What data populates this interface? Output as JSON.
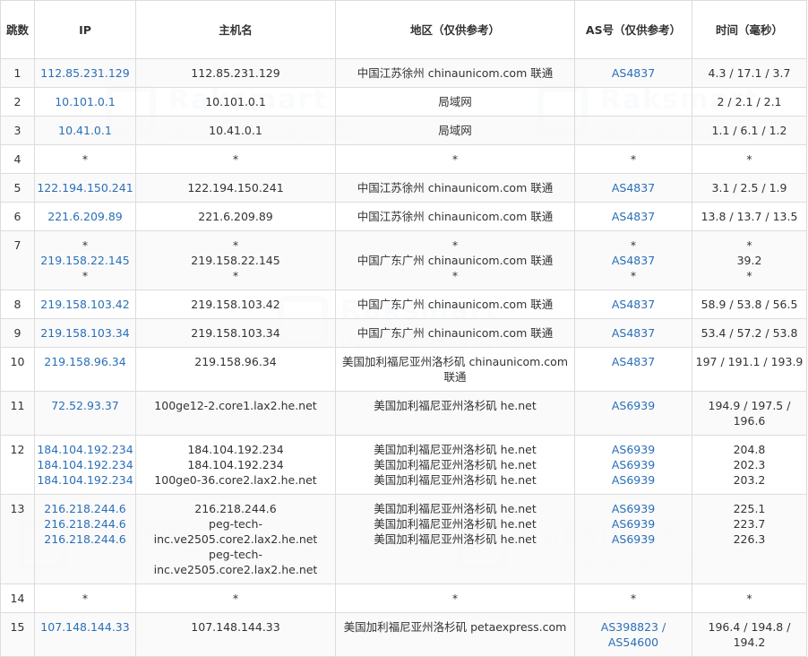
{
  "watermark": {
    "brand": "Raksmart",
    "tagline": "国外服务器评测"
  },
  "table": {
    "headers": {
      "hop": "跳数",
      "ip": "IP",
      "host": "主机名",
      "region": "地区（仅供参考）",
      "asn": "AS号（仅供参考）",
      "time": "时间（毫秒）"
    },
    "rows": [
      {
        "hop": "1",
        "ip": [
          "112.85.231.129"
        ],
        "host": [
          "112.85.231.129"
        ],
        "region": [
          "中国江苏徐州 chinaunicom.com 联通"
        ],
        "asn": [
          "AS4837"
        ],
        "time": [
          "4.3 / 17.1 / 3.7"
        ]
      },
      {
        "hop": "2",
        "ip": [
          "10.101.0.1"
        ],
        "host": [
          "10.101.0.1"
        ],
        "region": [
          "局域网"
        ],
        "asn": [],
        "time": [
          "2 / 2.1 / 2.1"
        ]
      },
      {
        "hop": "3",
        "ip": [
          "10.41.0.1"
        ],
        "host": [
          "10.41.0.1"
        ],
        "region": [
          "局域网"
        ],
        "asn": [],
        "time": [
          "1.1 / 6.1 / 1.2"
        ]
      },
      {
        "hop": "4",
        "ip": [
          "*"
        ],
        "host": [
          "*"
        ],
        "region": [
          "*"
        ],
        "asn": [
          "*"
        ],
        "time": [
          "*"
        ]
      },
      {
        "hop": "5",
        "ip": [
          "122.194.150.241"
        ],
        "host": [
          "122.194.150.241"
        ],
        "region": [
          "中国江苏徐州 chinaunicom.com 联通"
        ],
        "asn": [
          "AS4837"
        ],
        "time": [
          "3.1 / 2.5 / 1.9"
        ]
      },
      {
        "hop": "6",
        "ip": [
          "221.6.209.89"
        ],
        "host": [
          "221.6.209.89"
        ],
        "region": [
          "中国江苏徐州 chinaunicom.com 联通"
        ],
        "asn": [
          "AS4837"
        ],
        "time": [
          "13.8 / 13.7 / 13.5"
        ]
      },
      {
        "hop": "7",
        "ip": [
          "*",
          "219.158.22.145",
          "*"
        ],
        "host": [
          "*",
          "219.158.22.145",
          "*"
        ],
        "region": [
          "*",
          "中国广东广州 chinaunicom.com 联通",
          "*"
        ],
        "asn": [
          "*",
          "AS4837",
          "*"
        ],
        "time": [
          "*",
          "39.2",
          "*"
        ]
      },
      {
        "hop": "8",
        "ip": [
          "219.158.103.42"
        ],
        "host": [
          "219.158.103.42"
        ],
        "region": [
          "中国广东广州 chinaunicom.com 联通"
        ],
        "asn": [
          "AS4837"
        ],
        "time": [
          "58.9 / 53.8 / 56.5"
        ]
      },
      {
        "hop": "9",
        "ip": [
          "219.158.103.34"
        ],
        "host": [
          "219.158.103.34"
        ],
        "region": [
          "中国广东广州 chinaunicom.com 联通"
        ],
        "asn": [
          "AS4837"
        ],
        "time": [
          "53.4 / 57.2 / 53.8"
        ]
      },
      {
        "hop": "10",
        "ip": [
          "219.158.96.34"
        ],
        "host": [
          "219.158.96.34"
        ],
        "region": [
          "美国加利福尼亚州洛杉矶 chinaunicom.com 联通"
        ],
        "asn": [
          "AS4837"
        ],
        "time": [
          "197 / 191.1 / 193.9"
        ]
      },
      {
        "hop": "11",
        "ip": [
          "72.52.93.37"
        ],
        "host": [
          "100ge12-2.core1.lax2.he.net"
        ],
        "region": [
          "美国加利福尼亚州洛杉矶 he.net"
        ],
        "asn": [
          "AS6939"
        ],
        "time": [
          "194.9 / 197.5 / 196.6"
        ]
      },
      {
        "hop": "12",
        "ip": [
          "184.104.192.234",
          "184.104.192.234",
          "184.104.192.234"
        ],
        "host": [
          "184.104.192.234",
          "184.104.192.234",
          "100ge0-36.core2.lax2.he.net"
        ],
        "region": [
          "美国加利福尼亚州洛杉矶 he.net",
          "美国加利福尼亚州洛杉矶 he.net",
          "美国加利福尼亚州洛杉矶 he.net"
        ],
        "asn": [
          "AS6939",
          "AS6939",
          "AS6939"
        ],
        "time": [
          "204.8",
          "202.3",
          "203.2"
        ]
      },
      {
        "hop": "13",
        "ip": [
          "216.218.244.6",
          "216.218.244.6",
          "216.218.244.6"
        ],
        "host": [
          "216.218.244.6",
          "peg-tech-inc.ve2505.core2.lax2.he.net",
          "peg-tech-inc.ve2505.core2.lax2.he.net"
        ],
        "region": [
          "美国加利福尼亚州洛杉矶 he.net",
          "美国加利福尼亚州洛杉矶 he.net",
          "美国加利福尼亚州洛杉矶 he.net"
        ],
        "asn": [
          "AS6939",
          "AS6939",
          "AS6939"
        ],
        "time": [
          "225.1",
          "223.7",
          "226.3"
        ]
      },
      {
        "hop": "14",
        "ip": [
          "*"
        ],
        "host": [
          "*"
        ],
        "region": [
          "*"
        ],
        "asn": [
          "*"
        ],
        "time": [
          "*"
        ]
      },
      {
        "hop": "15",
        "ip": [
          "107.148.144.33"
        ],
        "host": [
          "107.148.144.33"
        ],
        "region": [
          "美国加利福尼亚州洛杉矶 petaexpress.com"
        ],
        "asn": [
          "AS398823 / AS54600"
        ],
        "time": [
          "196.4 / 194.8 / 194.2"
        ]
      }
    ]
  }
}
